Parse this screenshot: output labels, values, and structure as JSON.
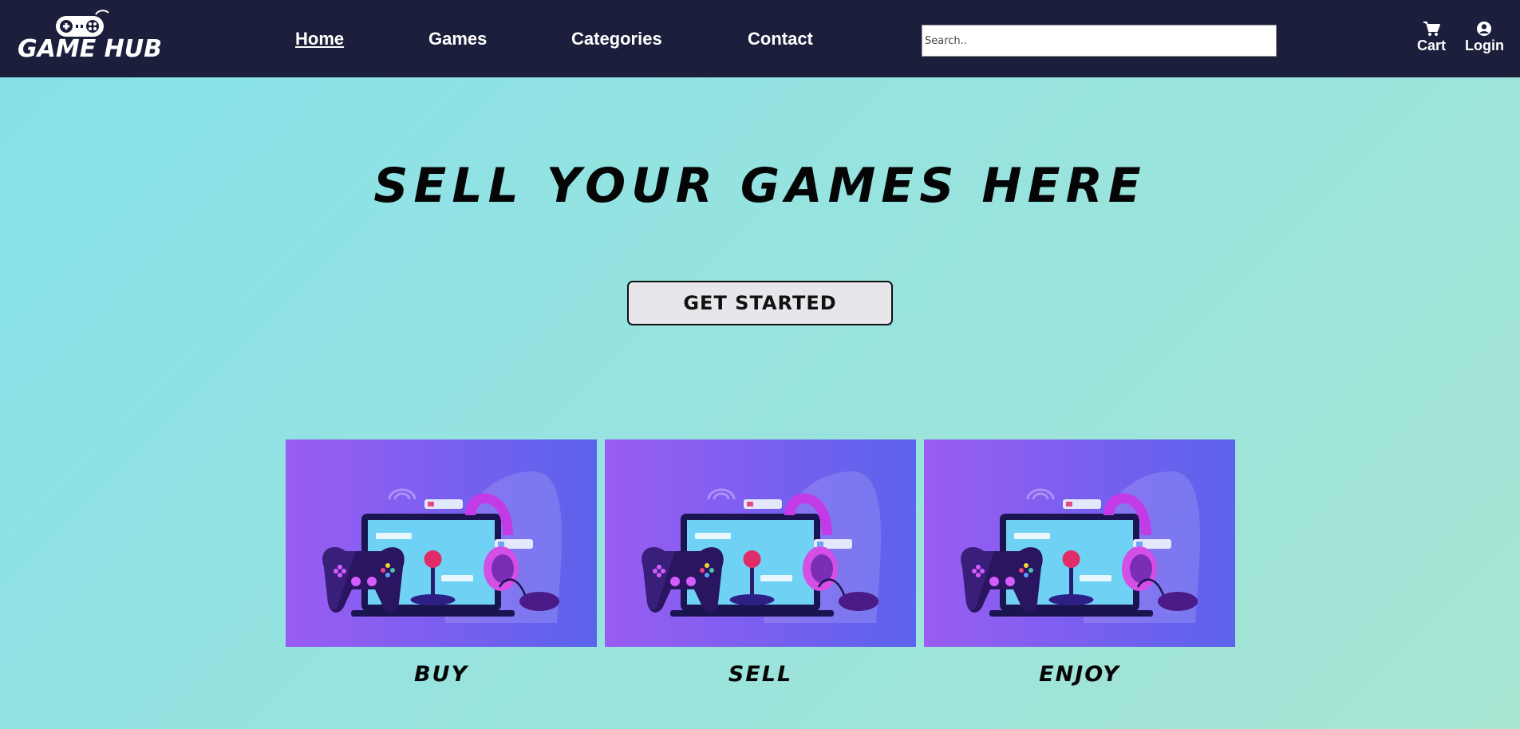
{
  "nav": {
    "logo_text": "GAME HUB",
    "logo_icon": "gamepad-icon",
    "links": [
      {
        "label": "Home",
        "active": true
      },
      {
        "label": "Games",
        "active": false
      },
      {
        "label": "Categories",
        "active": false
      },
      {
        "label": "Contact",
        "active": false
      }
    ],
    "search": {
      "placeholder": "Search..",
      "value": ""
    },
    "cart": {
      "label": "Cart",
      "icon": "cart-icon"
    },
    "login": {
      "label": "Login",
      "icon": "user-circle-icon"
    }
  },
  "hero": {
    "title": "SELL YOUR GAMES HERE",
    "cta_label": "GET STARTED"
  },
  "cards": [
    {
      "label": "BUY",
      "image": "gaming-setup-illustration"
    },
    {
      "label": "SELL",
      "image": "gaming-setup-illustration"
    },
    {
      "label": "ENJOY",
      "image": "gaming-setup-illustration"
    }
  ],
  "colors": {
    "navbar": "#1c1f3c",
    "background_start": "#86e1ea",
    "background_end": "#a6e5d2",
    "card_start": "#9a5cf2",
    "card_end": "#5b63ec",
    "text": "#050505"
  }
}
